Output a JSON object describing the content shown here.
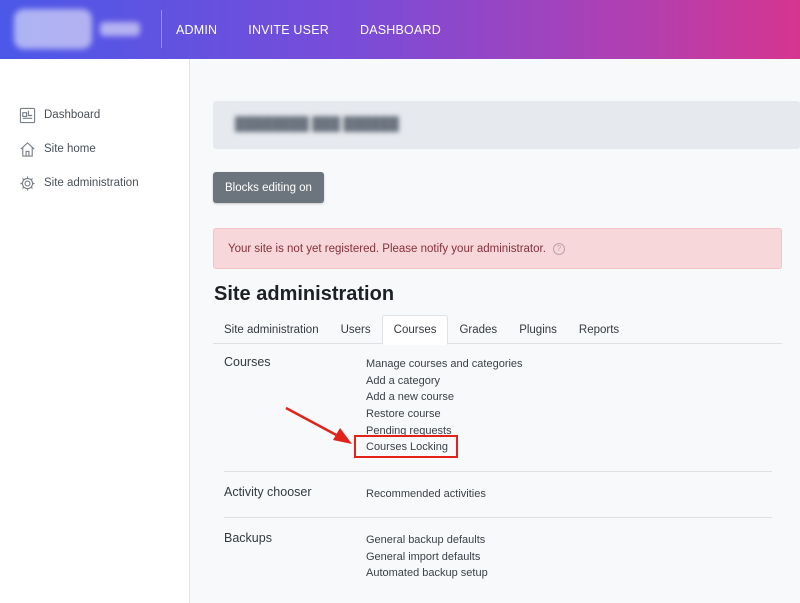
{
  "navbar": {
    "links": [
      "ADMIN",
      "INVITE USER",
      "DASHBOARD"
    ]
  },
  "sidebar": {
    "items": [
      {
        "label": "Dashboard",
        "icon": "dashboard-icon"
      },
      {
        "label": "Site home",
        "icon": "home-icon"
      },
      {
        "label": "Site administration",
        "icon": "gear-icon"
      }
    ]
  },
  "main": {
    "blocks_button_label": "Blocks editing on",
    "alert_text": "Your site is not yet registered. Please notify your administrator.",
    "page_title": "Site administration",
    "tabs": [
      {
        "label": "Site administration",
        "active": false
      },
      {
        "label": "Users",
        "active": false
      },
      {
        "label": "Courses",
        "active": true
      },
      {
        "label": "Grades",
        "active": false
      },
      {
        "label": "Plugins",
        "active": false
      },
      {
        "label": "Reports",
        "active": false
      }
    ],
    "sections": [
      {
        "title": "Courses",
        "links": [
          "Manage courses and categories",
          "Add a category",
          "Add a new course",
          "Restore course",
          "Pending requests",
          "Courses Locking"
        ]
      },
      {
        "title": "Activity chooser",
        "links": [
          "Recommended activities"
        ]
      },
      {
        "title": "Backups",
        "links": [
          "General backup defaults",
          "General import defaults",
          "Automated backup setup"
        ]
      }
    ]
  },
  "colors": {
    "annotation": "#e2231a",
    "alert_bg": "#f8d7da",
    "button_bg": "#6c757d"
  }
}
